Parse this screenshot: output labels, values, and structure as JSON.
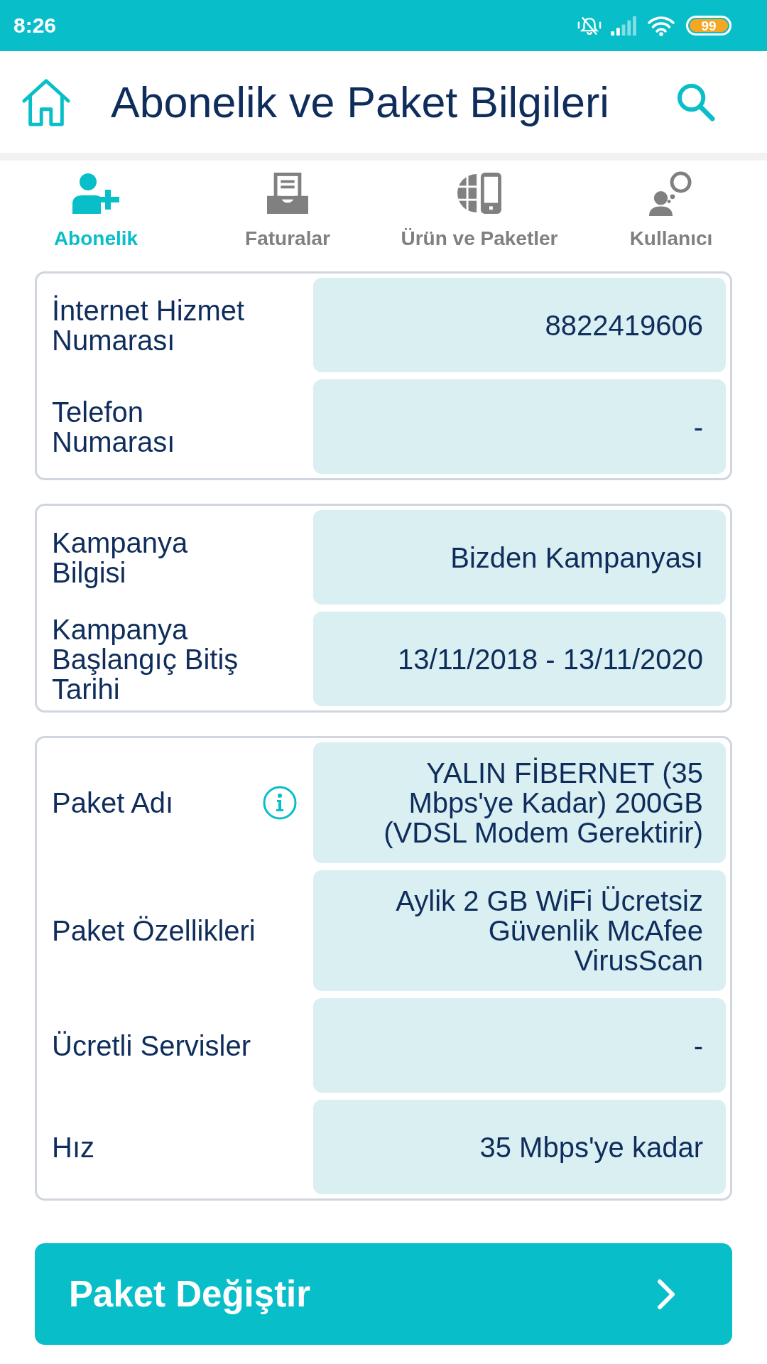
{
  "status_bar": {
    "time": "8:26",
    "battery": "99"
  },
  "header": {
    "title": "Abonelik ve Paket Bilgileri"
  },
  "tabs": [
    {
      "label": "Abonelik",
      "selected": true
    },
    {
      "label": "Faturalar",
      "selected": false
    },
    {
      "label": "Ürün ve Paketler",
      "selected": false
    },
    {
      "label": "Kullanıcı",
      "selected": false
    }
  ],
  "cards": [
    {
      "rows": [
        {
          "label": "İnternet Hizmet Numarası",
          "value": "8822419606"
        },
        {
          "label": "Telefon Numarası",
          "value": "-"
        }
      ]
    },
    {
      "rows": [
        {
          "label": "Kampanya Bilgisi",
          "value": "Bizden Kampanyası"
        },
        {
          "label": "Kampanya Başlangıç Bitiş Tarihi",
          "value": "13/11/2018 - 13/11/2020"
        }
      ]
    },
    {
      "rows": [
        {
          "label": "Paket Adı",
          "value": "YALIN FİBERNET (35 Mbps'ye Kadar) 200GB (VDSL Modem Gerektirir)",
          "info": true
        },
        {
          "label": "Paket Özellikleri",
          "value": "Aylik 2 GB WiFi Ücretsiz Güvenlik McAfee VirusScan"
        },
        {
          "label": "Ücretli Servisler",
          "value": "-"
        },
        {
          "label": "Hız",
          "value": "35 Mbps'ye kadar"
        }
      ]
    }
  ],
  "button": {
    "label": "Paket Değiştir"
  }
}
